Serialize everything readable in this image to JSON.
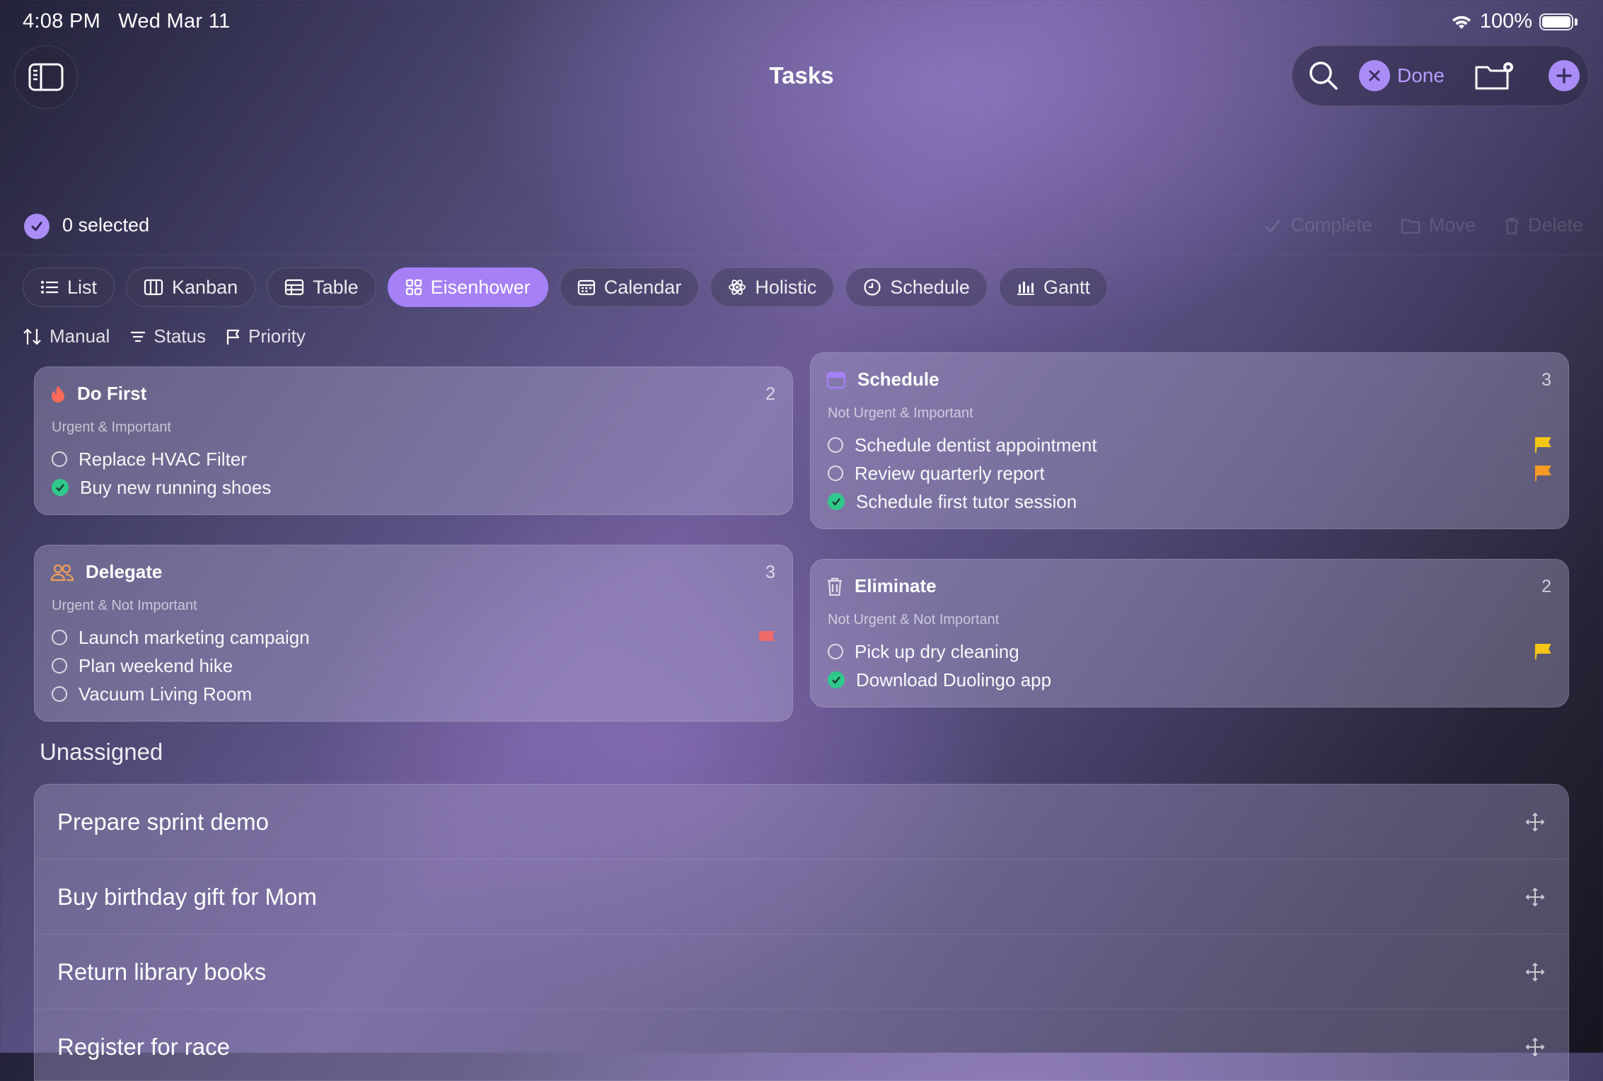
{
  "status_bar": {
    "time": "4:08 PM",
    "date": "Wed Mar 11",
    "battery": "100%"
  },
  "nav": {
    "title": "Tasks",
    "done_label": "Done"
  },
  "selection": {
    "count_label": "0 selected",
    "complete_label": "Complete",
    "move_label": "Move",
    "delete_label": "Delete"
  },
  "views": [
    {
      "label": "List",
      "icon": "list-icon"
    },
    {
      "label": "Kanban",
      "icon": "kanban-icon"
    },
    {
      "label": "Table",
      "icon": "table-icon"
    },
    {
      "label": "Eisenhower",
      "icon": "grid-icon",
      "active": true
    },
    {
      "label": "Calendar",
      "icon": "calendar-icon"
    },
    {
      "label": "Holistic",
      "icon": "atom-icon"
    },
    {
      "label": "Schedule",
      "icon": "clock-icon"
    },
    {
      "label": "Gantt",
      "icon": "bar-chart-icon"
    }
  ],
  "filters": {
    "sort": "Manual",
    "status": "Status",
    "priority": "Priority"
  },
  "quadrants": {
    "do_first": {
      "title": "Do First",
      "count": "2",
      "subtitle": "Urgent & Important",
      "tasks": [
        {
          "title": "Replace HVAC Filter",
          "done": false
        },
        {
          "title": "Buy new running shoes",
          "done": true
        }
      ]
    },
    "schedule": {
      "title": "Schedule",
      "count": "3",
      "subtitle": "Not Urgent & Important",
      "tasks": [
        {
          "title": "Schedule dentist appointment",
          "done": false,
          "flag": "#f5c518"
        },
        {
          "title": "Review quarterly report",
          "done": false,
          "flag": "#f59a23"
        },
        {
          "title": "Schedule first tutor session",
          "done": true
        }
      ]
    },
    "delegate": {
      "title": "Delegate",
      "count": "3",
      "subtitle": "Urgent & Not Important",
      "tasks": [
        {
          "title": "Launch marketing campaign",
          "done": false,
          "flag": "#f06b6b"
        },
        {
          "title": "Plan weekend hike",
          "done": false
        },
        {
          "title": "Vacuum Living Room",
          "done": false
        }
      ]
    },
    "eliminate": {
      "title": "Eliminate",
      "count": "2",
      "subtitle": "Not Urgent & Not Important",
      "tasks": [
        {
          "title": "Pick up dry cleaning",
          "done": false,
          "flag": "#f5c518"
        },
        {
          "title": "Download Duolingo app",
          "done": true
        }
      ]
    }
  },
  "unassigned": {
    "title": "Unassigned",
    "tasks": [
      "Prepare sprint demo",
      "Buy birthday gift for Mom",
      "Return library books",
      "Register for race"
    ]
  },
  "colors": {
    "accent": "#a580f7",
    "done_green": "#2fc98c",
    "fire": "#ff6a5a",
    "delegate_orange": "#f0a05a"
  }
}
